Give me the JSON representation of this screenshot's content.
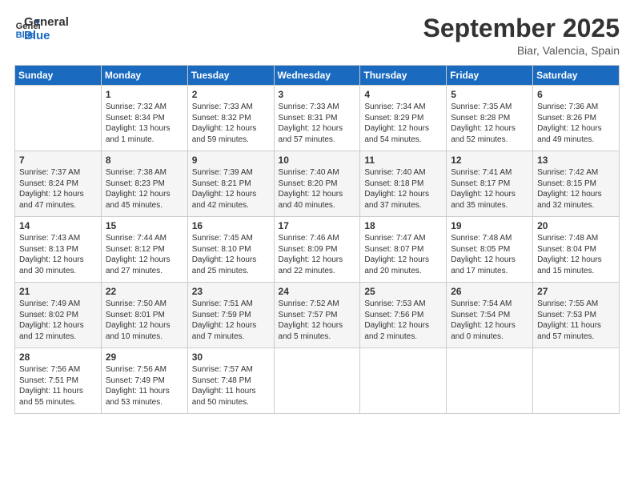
{
  "header": {
    "logo_line1": "General",
    "logo_line2": "Blue",
    "month": "September 2025",
    "location": "Biar, Valencia, Spain"
  },
  "days_of_week": [
    "Sunday",
    "Monday",
    "Tuesday",
    "Wednesday",
    "Thursday",
    "Friday",
    "Saturday"
  ],
  "weeks": [
    [
      {
        "day": "",
        "content": ""
      },
      {
        "day": "1",
        "content": "Sunrise: 7:32 AM\nSunset: 8:34 PM\nDaylight: 13 hours\nand 1 minute."
      },
      {
        "day": "2",
        "content": "Sunrise: 7:33 AM\nSunset: 8:32 PM\nDaylight: 12 hours\nand 59 minutes."
      },
      {
        "day": "3",
        "content": "Sunrise: 7:33 AM\nSunset: 8:31 PM\nDaylight: 12 hours\nand 57 minutes."
      },
      {
        "day": "4",
        "content": "Sunrise: 7:34 AM\nSunset: 8:29 PM\nDaylight: 12 hours\nand 54 minutes."
      },
      {
        "day": "5",
        "content": "Sunrise: 7:35 AM\nSunset: 8:28 PM\nDaylight: 12 hours\nand 52 minutes."
      },
      {
        "day": "6",
        "content": "Sunrise: 7:36 AM\nSunset: 8:26 PM\nDaylight: 12 hours\nand 49 minutes."
      }
    ],
    [
      {
        "day": "7",
        "content": "Sunrise: 7:37 AM\nSunset: 8:24 PM\nDaylight: 12 hours\nand 47 minutes."
      },
      {
        "day": "8",
        "content": "Sunrise: 7:38 AM\nSunset: 8:23 PM\nDaylight: 12 hours\nand 45 minutes."
      },
      {
        "day": "9",
        "content": "Sunrise: 7:39 AM\nSunset: 8:21 PM\nDaylight: 12 hours\nand 42 minutes."
      },
      {
        "day": "10",
        "content": "Sunrise: 7:40 AM\nSunset: 8:20 PM\nDaylight: 12 hours\nand 40 minutes."
      },
      {
        "day": "11",
        "content": "Sunrise: 7:40 AM\nSunset: 8:18 PM\nDaylight: 12 hours\nand 37 minutes."
      },
      {
        "day": "12",
        "content": "Sunrise: 7:41 AM\nSunset: 8:17 PM\nDaylight: 12 hours\nand 35 minutes."
      },
      {
        "day": "13",
        "content": "Sunrise: 7:42 AM\nSunset: 8:15 PM\nDaylight: 12 hours\nand 32 minutes."
      }
    ],
    [
      {
        "day": "14",
        "content": "Sunrise: 7:43 AM\nSunset: 8:13 PM\nDaylight: 12 hours\nand 30 minutes."
      },
      {
        "day": "15",
        "content": "Sunrise: 7:44 AM\nSunset: 8:12 PM\nDaylight: 12 hours\nand 27 minutes."
      },
      {
        "day": "16",
        "content": "Sunrise: 7:45 AM\nSunset: 8:10 PM\nDaylight: 12 hours\nand 25 minutes."
      },
      {
        "day": "17",
        "content": "Sunrise: 7:46 AM\nSunset: 8:09 PM\nDaylight: 12 hours\nand 22 minutes."
      },
      {
        "day": "18",
        "content": "Sunrise: 7:47 AM\nSunset: 8:07 PM\nDaylight: 12 hours\nand 20 minutes."
      },
      {
        "day": "19",
        "content": "Sunrise: 7:48 AM\nSunset: 8:05 PM\nDaylight: 12 hours\nand 17 minutes."
      },
      {
        "day": "20",
        "content": "Sunrise: 7:48 AM\nSunset: 8:04 PM\nDaylight: 12 hours\nand 15 minutes."
      }
    ],
    [
      {
        "day": "21",
        "content": "Sunrise: 7:49 AM\nSunset: 8:02 PM\nDaylight: 12 hours\nand 12 minutes."
      },
      {
        "day": "22",
        "content": "Sunrise: 7:50 AM\nSunset: 8:01 PM\nDaylight: 12 hours\nand 10 minutes."
      },
      {
        "day": "23",
        "content": "Sunrise: 7:51 AM\nSunset: 7:59 PM\nDaylight: 12 hours\nand 7 minutes."
      },
      {
        "day": "24",
        "content": "Sunrise: 7:52 AM\nSunset: 7:57 PM\nDaylight: 12 hours\nand 5 minutes."
      },
      {
        "day": "25",
        "content": "Sunrise: 7:53 AM\nSunset: 7:56 PM\nDaylight: 12 hours\nand 2 minutes."
      },
      {
        "day": "26",
        "content": "Sunrise: 7:54 AM\nSunset: 7:54 PM\nDaylight: 12 hours\nand 0 minutes."
      },
      {
        "day": "27",
        "content": "Sunrise: 7:55 AM\nSunset: 7:53 PM\nDaylight: 11 hours\nand 57 minutes."
      }
    ],
    [
      {
        "day": "28",
        "content": "Sunrise: 7:56 AM\nSunset: 7:51 PM\nDaylight: 11 hours\nand 55 minutes."
      },
      {
        "day": "29",
        "content": "Sunrise: 7:56 AM\nSunset: 7:49 PM\nDaylight: 11 hours\nand 53 minutes."
      },
      {
        "day": "30",
        "content": "Sunrise: 7:57 AM\nSunset: 7:48 PM\nDaylight: 11 hours\nand 50 minutes."
      },
      {
        "day": "",
        "content": ""
      },
      {
        "day": "",
        "content": ""
      },
      {
        "day": "",
        "content": ""
      },
      {
        "day": "",
        "content": ""
      }
    ]
  ]
}
